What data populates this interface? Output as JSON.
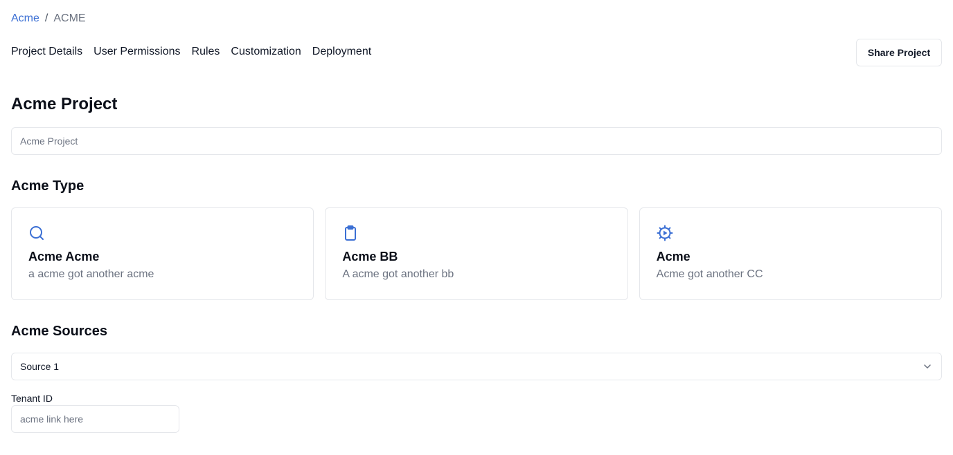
{
  "breadcrumb": {
    "link": "Acme",
    "separator": "/",
    "current": "ACME"
  },
  "nav": {
    "tabs": [
      "Project Details",
      "User Permissions",
      "Rules",
      "Customization",
      "Deployment"
    ]
  },
  "header": {
    "share_label": "Share Project"
  },
  "project": {
    "title": "Acme Project",
    "input_placeholder": "Acme Project"
  },
  "type": {
    "title": "Acme Type",
    "cards": [
      {
        "icon": "search-icon",
        "title": "Acme Acme",
        "desc": "a acme got another acme"
      },
      {
        "icon": "clipboard-icon",
        "title": "Acme BB",
        "desc": "A acme got another bb"
      },
      {
        "icon": "gear-play-icon",
        "title": "Acme",
        "desc": "Acme got another CC"
      }
    ]
  },
  "sources": {
    "title": "Acme Sources",
    "selected": "Source 1"
  },
  "tenant": {
    "label": "Tenant ID",
    "placeholder": "acme link here"
  },
  "colors": {
    "accent": "#3b6fd4",
    "border": "#e5e7eb",
    "muted": "#6b7280"
  }
}
